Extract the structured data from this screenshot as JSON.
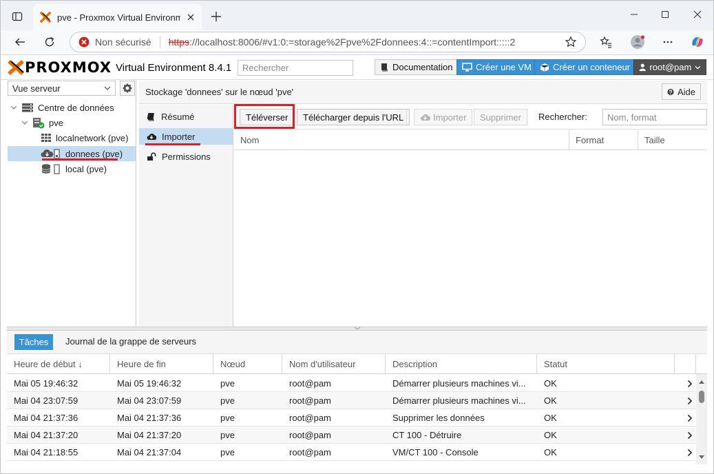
{
  "browser": {
    "tab_title": "pve - Proxmox Virtual Environment",
    "security_label": "Non sécurisé",
    "url_scheme": "https",
    "url_rest": "://localhost:8006/#v1:0:=storage%2Fpve%2Fdonnees:4::=contentImport:::::2"
  },
  "header": {
    "logo_text": "PROXMOX",
    "product": "Virtual Environment 8.4.1",
    "search_placeholder": "Rechercher",
    "doc_label": "Documentation",
    "create_vm_label": "Créer une VM",
    "create_ct_label": "Créer un conteneur",
    "user_label": "root@pam"
  },
  "sidebar": {
    "view_label": "Vue serveur",
    "tree": {
      "datacenter": "Centre de données",
      "node": "pve",
      "items": [
        "localnetwork (pve)",
        "donnees (pve)",
        "local (pve)"
      ]
    }
  },
  "main": {
    "title": "Stockage 'donnees' sur le nœud 'pve'",
    "help_label": "Aide",
    "nav": [
      "Résumé",
      "Importer",
      "Permissions"
    ],
    "toolbar": {
      "upload": "Téléverser",
      "download_url": "Télécharger depuis l'URL",
      "import": "Importer",
      "delete": "Supprimer",
      "search_label": "Rechercher:",
      "search_placeholder": "Nom, format"
    },
    "columns": [
      "Nom",
      "Format",
      "Taille"
    ]
  },
  "tasks": {
    "tab_label": "Tâches",
    "cluster_log_label": "Journal de la grappe de serveurs",
    "columns": [
      "Heure de début ↓",
      "Heure de fin",
      "Nœud",
      "Nom d'utilisateur",
      "Description",
      "Statut"
    ],
    "rows": [
      [
        "Mai 05 19:46:32",
        "Mai 05 19:46:32",
        "pve",
        "root@pam",
        "Démarrer plusieurs machines vi...",
        "OK"
      ],
      [
        "Mai 04 23:07:59",
        "Mai 04 23:07:59",
        "pve",
        "root@pam",
        "Démarrer plusieurs machines vi...",
        "OK"
      ],
      [
        "Mai 04 21:37:36",
        "Mai 04 21:37:36",
        "pve",
        "root@pam",
        "Supprimer les données",
        "OK"
      ],
      [
        "Mai 04 21:37:20",
        "Mai 04 21:37:20",
        "pve",
        "root@pam",
        "CT 100 - Détruire",
        "OK"
      ],
      [
        "Mai 04 21:18:55",
        "Mai 04 21:37:04",
        "pve",
        "root@pam",
        "VM/CT 100 - Console",
        "OK"
      ]
    ]
  },
  "colors": {
    "accent_blue": "#3892d4",
    "proxmox_orange": "#e57000",
    "highlight_red": "#d81f26",
    "selection_blue": "#c4dcf2"
  }
}
